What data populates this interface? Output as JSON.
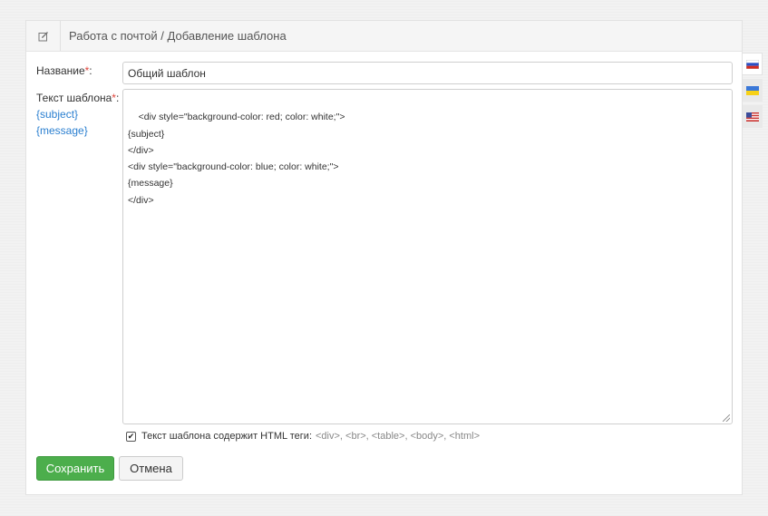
{
  "header": {
    "title": "Работа с почтой / Добавление шаблона",
    "icon": "edit-icon"
  },
  "form": {
    "name_label": "Название",
    "required_mark": "*",
    "colon": ":",
    "name_value": "Общий шаблон",
    "template_label": "Текст шаблона",
    "variables": [
      "{subject}",
      "{message}"
    ],
    "template_text": "<div style=\"background-color: red; color: white;\">\n{subject}\n</div>\n<div style=\"background-color: blue; color: white;\">\n{message}\n</div>",
    "html_checkbox_checked": true,
    "html_checkbox_label": "Текст шаблона содержит HTML теги:",
    "html_tags_hint": "<div>, <br>, <table>, <body>, <html>"
  },
  "buttons": {
    "save_label": "Сохранить",
    "cancel_label": "Отмена"
  },
  "languages": [
    {
      "code": "ru",
      "icon": "flag-ru-icon",
      "active": true
    },
    {
      "code": "ua",
      "icon": "flag-ua-icon",
      "active": false
    },
    {
      "code": "us",
      "icon": "flag-us-icon",
      "active": false
    }
  ],
  "colors": {
    "save_button": "#4cae4c",
    "link": "#2a7fd0",
    "required": "#e0463c"
  }
}
